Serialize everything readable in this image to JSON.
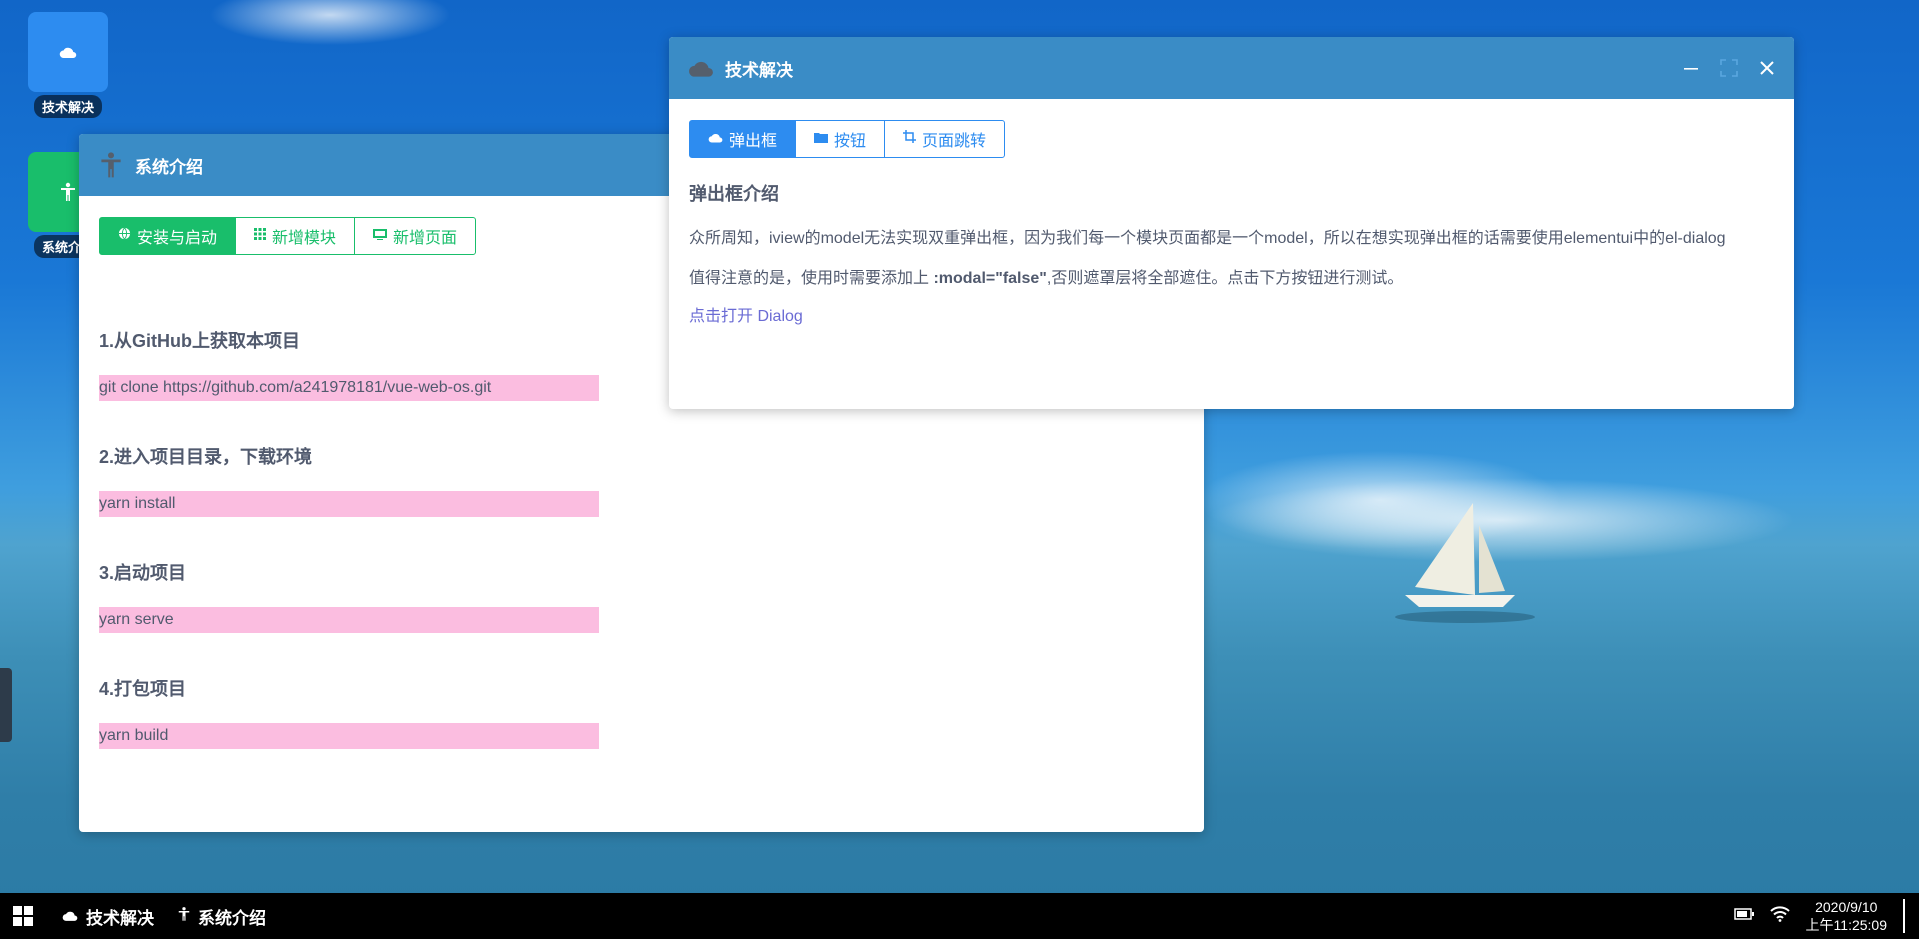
{
  "desktop": {
    "icons": [
      {
        "label": "技术解决",
        "icon": "cloud-icon",
        "color": "#2d8cf0"
      },
      {
        "label": "系统介绍",
        "icon": "accessibility-icon",
        "color": "#19be6b"
      }
    ]
  },
  "system_window": {
    "title": "系统介绍",
    "tabs": [
      {
        "label": "安装与启动",
        "icon": "globe-icon",
        "active": true
      },
      {
        "label": "新增模块",
        "icon": "grid-icon",
        "active": false
      },
      {
        "label": "新增页面",
        "icon": "monitor-icon",
        "active": false
      }
    ],
    "steps": [
      {
        "heading": "1.从GitHub上获取本项目",
        "code": "git clone https://github.com/a241978181/vue-web-os.git"
      },
      {
        "heading": "2.进入项目目录，下载环境",
        "code": "yarn install"
      },
      {
        "heading": "3.启动项目",
        "code": "yarn serve"
      },
      {
        "heading": "4.打包项目",
        "code": "yarn build"
      }
    ]
  },
  "tech_window": {
    "title": "技术解决",
    "tabs": [
      {
        "label": "弹出框",
        "icon": "cloud-icon",
        "active": true
      },
      {
        "label": "按钮",
        "icon": "folder-icon",
        "active": false
      },
      {
        "label": "页面跳转",
        "icon": "crop-icon",
        "active": false
      }
    ],
    "heading": "弹出框介绍",
    "para1": "众所周知，iview的model无法实现双重弹出框，因为我们每一个模块页面都是一个model，所以在想实现弹出框的话需要使用elementui中的el-dialog",
    "para2_prefix": "值得注意的是，使用时需要添加上 ",
    "para2_code": ":modal=\"false\"",
    "para2_suffix": ",否则遮罩层将全部遮住。点击下方按钮进行测试。",
    "link": "点击打开 Dialog"
  },
  "taskbar": {
    "items": [
      {
        "label": "技术解决",
        "icon": "cloud-icon"
      },
      {
        "label": "系统介绍",
        "icon": "accessibility-icon"
      }
    ],
    "date": "2020/9/10",
    "time": "上午11:25:09"
  },
  "colors": {
    "titlebar": "#3a8cc6",
    "green": "#19be6b",
    "blue": "#2d8cf0",
    "code_bg": "#fbbde0"
  }
}
